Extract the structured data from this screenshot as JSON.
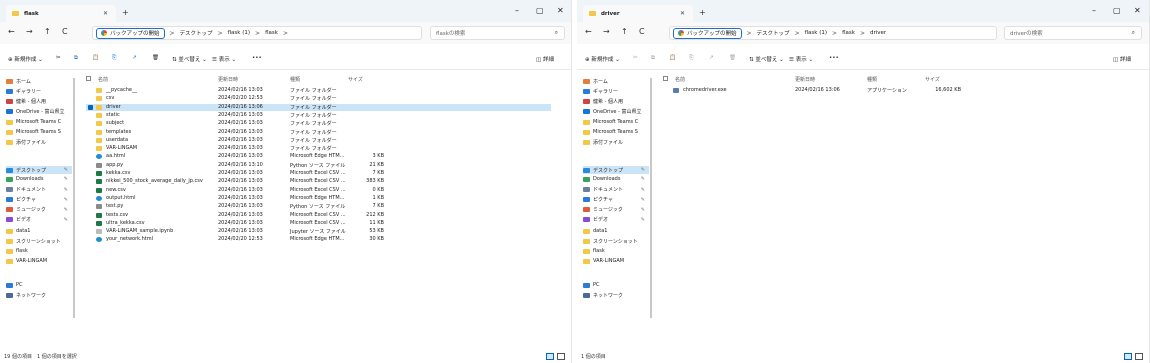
{
  "common": {
    "new_tab": "+",
    "minimize": "–",
    "maximize": "▢",
    "close": "✕",
    "back": "←",
    "forward": "→",
    "up": "↑",
    "refresh": "C",
    "backup_label": "バックアップの開始",
    "crumb_desktop": "デスクトップ",
    "crumb_flask1": "flask (1)",
    "crumb_flask": "flask",
    "separator": ">",
    "toolbar": {
      "new": "新規作成",
      "sort": "並べ替え",
      "view": "表示",
      "more": "•••",
      "details": "詳細"
    },
    "columns": {
      "name": "名前",
      "date": "更新日時",
      "type": "種類",
      "size": "サイズ"
    },
    "sidebar": [
      {
        "label": "ホーム",
        "icon": "home-icon",
        "color": "#e0803a"
      },
      {
        "label": "ギャラリー",
        "icon": "gallery-icon",
        "color": "#2b7bd6"
      },
      {
        "label": "健希 - 個人用",
        "icon": "onedrive-personal-icon",
        "color": "#c44"
      },
      {
        "label": "OneDrive - 富山県立",
        "icon": "onedrive-icon",
        "color": "#1a73d6"
      },
      {
        "label": "Microsoft Teams C",
        "icon": "folder-icon",
        "color": "#f3c748"
      },
      {
        "label": "Microsoft Teams S",
        "icon": "folder-icon",
        "color": "#f3c748"
      },
      {
        "label": "添付ファイル",
        "icon": "folder-icon",
        "color": "#f3c748"
      },
      {
        "label": "デスクトップ",
        "icon": "desktop-icon",
        "color": "#2b8bd6",
        "pin": true
      },
      {
        "label": "Downloads",
        "icon": "download-icon",
        "color": "#3aa35a",
        "pin": true
      },
      {
        "label": "ドキュメント",
        "icon": "documents-icon",
        "color": "#6b7fa0",
        "pin": true
      },
      {
        "label": "ピクチャ",
        "icon": "pictures-icon",
        "color": "#2b7bd6",
        "pin": true
      },
      {
        "label": "ミュージック",
        "icon": "music-icon",
        "color": "#e05a3a",
        "pin": true
      },
      {
        "label": "ビデオ",
        "icon": "videos-icon",
        "color": "#8a4ad6",
        "pin": true
      },
      {
        "label": "data1",
        "icon": "folder-icon",
        "color": "#f3c748"
      },
      {
        "label": "スクリーンショット",
        "icon": "folder-icon",
        "color": "#f3c748"
      },
      {
        "label": "flask",
        "icon": "folder-icon",
        "color": "#f3c748"
      },
      {
        "label": "VAR-LiNGAM",
        "icon": "folder-icon",
        "color": "#f3c748"
      },
      {
        "label": "PC",
        "icon": "pc-icon",
        "color": "#2b7bd6"
      },
      {
        "label": "ネットワーク",
        "icon": "network-icon",
        "color": "#4a6a9a"
      }
    ]
  },
  "window1": {
    "tab_title": "flask",
    "search_placeholder": "flaskの検索",
    "status": "19 個の項目　1 個の項目を選択",
    "files": [
      {
        "name": "__pycache__",
        "date": "2024/02/16 13:03",
        "type": "ファイル フォルダー",
        "size": "",
        "icon": "folder-icon",
        "color": "#f3c748"
      },
      {
        "name": "csv",
        "date": "2024/02/20 12:53",
        "type": "ファイル フォルダー",
        "size": "",
        "icon": "folder-icon",
        "color": "#f3c748"
      },
      {
        "name": "driver",
        "date": "2024/02/16 13:06",
        "type": "ファイル フォルダー",
        "size": "",
        "icon": "folder-icon",
        "color": "#f3c748",
        "selected": true
      },
      {
        "name": "static",
        "date": "2024/02/16 13:03",
        "type": "ファイル フォルダー",
        "size": "",
        "icon": "folder-icon",
        "color": "#f3c748"
      },
      {
        "name": "subject",
        "date": "2024/02/16 13:03",
        "type": "ファイル フォルダー",
        "size": "",
        "icon": "folder-icon",
        "color": "#f3c748"
      },
      {
        "name": "templates",
        "date": "2024/02/16 13:03",
        "type": "ファイル フォルダー",
        "size": "",
        "icon": "folder-icon",
        "color": "#f3c748"
      },
      {
        "name": "userdata",
        "date": "2024/02/16 13:03",
        "type": "ファイル フォルダー",
        "size": "",
        "icon": "folder-icon",
        "color": "#f3c748"
      },
      {
        "name": "VAR-LiNGAM",
        "date": "2024/02/16 13:03",
        "type": "ファイル フォルダー",
        "size": "",
        "icon": "folder-icon",
        "color": "#f3c748"
      },
      {
        "name": "aa.html",
        "date": "2024/02/16 13:03",
        "type": "Microsoft Edge HTM...",
        "size": "3 KB",
        "icon": "edge-icon",
        "color": "#1f8fd0"
      },
      {
        "name": "app.py",
        "date": "2024/02/16 13:10",
        "type": "Python ソース ファイル",
        "size": "21 KB",
        "icon": "python-icon",
        "color": "#8a8a8a"
      },
      {
        "name": "kekka.csv",
        "date": "2024/02/16 13:03",
        "type": "Microsoft Excel CSV ...",
        "size": "7 KB",
        "icon": "excel-icon",
        "color": "#1d7a45"
      },
      {
        "name": "nikkei_500_stock_average_daily_jp.csv",
        "date": "2024/02/16 13:03",
        "type": "Microsoft Excel CSV ...",
        "size": "383 KB",
        "icon": "excel-icon",
        "color": "#1d7a45"
      },
      {
        "name": "new.csv",
        "date": "2024/02/16 13:03",
        "type": "Microsoft Excel CSV ...",
        "size": "0 KB",
        "icon": "excel-icon",
        "color": "#1d7a45"
      },
      {
        "name": "output.html",
        "date": "2024/02/16 13:03",
        "type": "Microsoft Edge HTM...",
        "size": "1 KB",
        "icon": "edge-icon",
        "color": "#1f8fd0"
      },
      {
        "name": "test.py",
        "date": "2024/02/16 13:03",
        "type": "Python ソース ファイル",
        "size": "7 KB",
        "icon": "python-icon",
        "color": "#8a8a8a"
      },
      {
        "name": "tests.csv",
        "date": "2024/02/16 13:03",
        "type": "Microsoft Excel CSV ...",
        "size": "212 KB",
        "icon": "excel-icon",
        "color": "#1d7a45"
      },
      {
        "name": "ultra_kekka.csv",
        "date": "2024/02/16 13:03",
        "type": "Microsoft Excel CSV ...",
        "size": "11 KB",
        "icon": "excel-icon",
        "color": "#1d7a45"
      },
      {
        "name": "VAR-LiNGAM_sample.ipynb",
        "date": "2024/02/16 13:03",
        "type": "Jupyter ソース ファイル",
        "size": "53 KB",
        "icon": "notebook-icon",
        "color": "#bbbbbb"
      },
      {
        "name": "your_network.html",
        "date": "2024/02/20 12:53",
        "type": "Microsoft Edge HTM...",
        "size": "30 KB",
        "icon": "edge-icon",
        "color": "#1f8fd0"
      }
    ]
  },
  "window2": {
    "tab_title": "driver",
    "crumb_driver": "driver",
    "search_placeholder": "driverの検索",
    "status": "1 個の項目",
    "files": [
      {
        "name": "chromedriver.exe",
        "date": "2024/02/16 13:06",
        "type": "アプリケーション",
        "size": "16,602 KB",
        "icon": "exe-icon",
        "color": "#5a7ab0"
      }
    ]
  }
}
